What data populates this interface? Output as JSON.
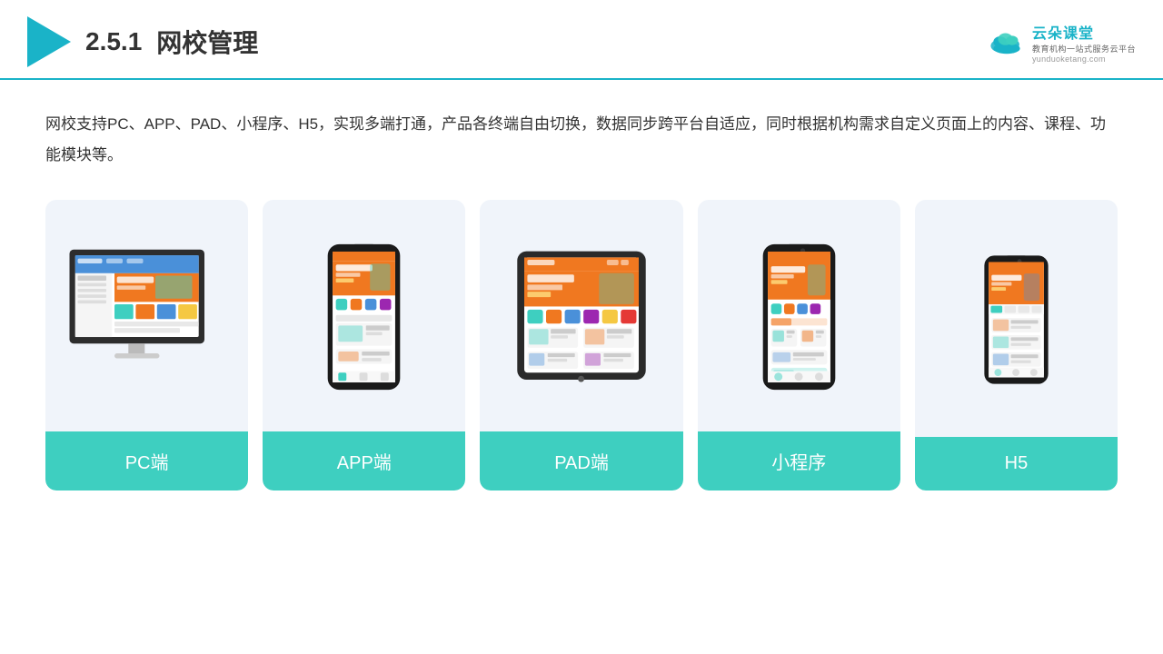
{
  "header": {
    "section": "2.5.1",
    "title": "网校管理",
    "brand": {
      "name": "云朵课堂",
      "tagline": "教育机构一站式服务云平台",
      "url": "yunduoketang.com"
    }
  },
  "description": "网校支持PC、APP、PAD、小程序、H5，实现多端打通，产品各终端自由切换，数据同步跨平台自适应，同时根据机构需求自定义页面上的内容、课程、功能模块等。",
  "cards": [
    {
      "id": "pc",
      "label": "PC端"
    },
    {
      "id": "app",
      "label": "APP端"
    },
    {
      "id": "pad",
      "label": "PAD端"
    },
    {
      "id": "mini-program",
      "label": "小程序"
    },
    {
      "id": "h5",
      "label": "H5"
    }
  ],
  "accent_color": "#3ecfc0",
  "bg_color": "#f0f4fa"
}
